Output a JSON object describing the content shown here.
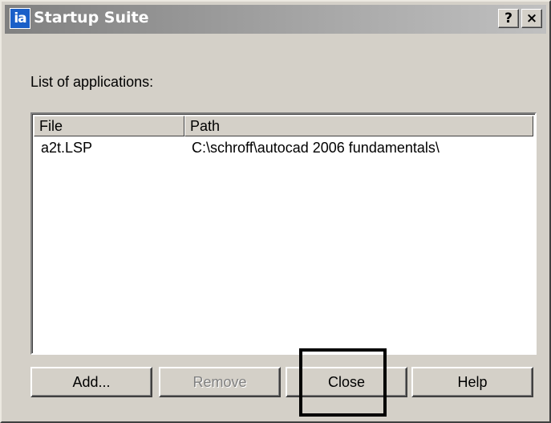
{
  "window": {
    "title": "Startup Suite",
    "icon_name": "autocad-app-icon",
    "icon_glyph": "ia",
    "titlebar_buttons": {
      "help_label": "?",
      "close_label": "×"
    }
  },
  "dialog": {
    "list_label": "List of applications:",
    "columns": [
      {
        "label": "File"
      },
      {
        "label": "Path"
      }
    ],
    "rows": [
      {
        "file": "a2t.LSP",
        "path": "C:\\schroff\\autocad 2006 fundamentals\\"
      }
    ]
  },
  "buttons": {
    "add_label": "Add...",
    "remove_label": "Remove",
    "close_label": "Close",
    "help_label": "Help"
  },
  "colors": {
    "face": "#d4d0c8",
    "highlight_box": "#000000",
    "disabled_text": "#808080"
  }
}
